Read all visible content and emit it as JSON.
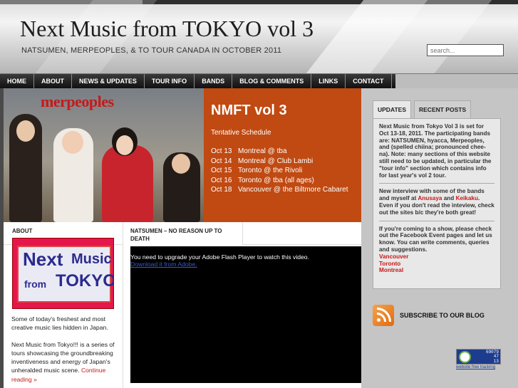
{
  "header": {
    "title": "Next Music from TOKYO vol 3",
    "tagline": "NATSUMEN, MERPEOPLES,    &    TO TOUR CANADA IN OCTOBER 2011",
    "search_placeholder": "search..."
  },
  "nav": {
    "items": [
      {
        "label": "HOME"
      },
      {
        "label": "ABOUT"
      },
      {
        "label": "NEWS & UPDATES"
      },
      {
        "label": "TOUR INFO"
      },
      {
        "label": "BANDS"
      },
      {
        "label": "BLOG & COMMENTS"
      },
      {
        "label": "LINKS"
      },
      {
        "label": "CONTACT"
      }
    ]
  },
  "hero": {
    "brand": "merpeoples",
    "title": "NMFT vol 3",
    "subtitle": "Tentative Schedule",
    "schedule": [
      {
        "date": "Oct 13",
        "place": "Montreal @ tba"
      },
      {
        "date": "Oct 14",
        "place": "Montreal @ Club Lambi"
      },
      {
        "date": "Oct 15",
        "place": "Toronto @ the Rivoli"
      },
      {
        "date": "Oct 16",
        "place": "Toronto @ tba (all ages)"
      },
      {
        "date": "Oct 18",
        "place": "Vancouver @ the Biltmore Cabaret"
      }
    ]
  },
  "about": {
    "heading": "ABOUT",
    "logo_text": [
      "Next",
      "Music",
      "from",
      "TOKYO"
    ],
    "para1": "Some of today's freshest and most creative music lies hidden in Japan.",
    "para2": "Next Music from Tokyo!!! is a series of tours showcasing the groundbreaking inventiveness and energy of Japan's unheralded music scene.",
    "more": "Continue reading »"
  },
  "video": {
    "heading": "NATSUMEN – NO REASON UP TO DEATH",
    "message": "You need to upgrade your Adobe Flash Player to watch this video.",
    "link": "Download it from Adobe."
  },
  "sidebar": {
    "tabs": [
      {
        "label": "UPDATES",
        "active": true
      },
      {
        "label": "RECENT POSTS",
        "active": false
      }
    ],
    "update1": "Next Music from Tokyo Vol 3 is set for Oct 13-18, 2011. The participating bands are: NATSUMEN, hyacca, Merpeoples, and      (spelled chiina; pronounced chee-na). Note: many sections of this website still need to be updated, in particular the \"tour info\" section which contains info for last year's vol 2 tour.",
    "update2_pre": "New interview with some of the bands and myself at ",
    "update2_link1": "Anusaya",
    "update2_and": " and ",
    "update2_link2": "Keikaku",
    "update2_post": ". Even if you don't read the inteview, check out the sites b/c they're both great!",
    "update3": "If you're coming to a show, please check out the Facebook Event pages and let us know. You can write comments, queries and suggestions.",
    "cities": [
      "Vancouver",
      "Toronto",
      "Montreal"
    ],
    "subscribe": "SUBSCRIBE TO OUR BLOG",
    "counter": [
      "69079",
      "47",
      "13"
    ],
    "counter_caption": "website free tracking"
  }
}
